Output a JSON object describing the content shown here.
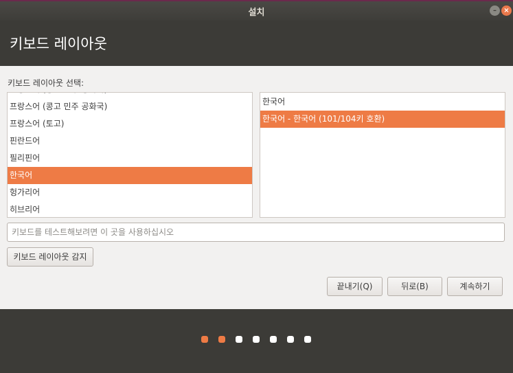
{
  "window": {
    "title": "설치"
  },
  "header": {
    "title": "키보드 레이아웃"
  },
  "layout_list": {
    "label": "키보드 레이아웃 선택:",
    "items": [
      {
        "label": "프랑스어 (콩고 민주 공화국)",
        "selected": false
      },
      {
        "label": "프랑스어 (콩고 민주 공화국)",
        "selected": false
      },
      {
        "label": "프랑스어 (토고)",
        "selected": false
      },
      {
        "label": "핀란드어",
        "selected": false
      },
      {
        "label": "필리핀어",
        "selected": false
      },
      {
        "label": "한국어",
        "selected": true
      },
      {
        "label": "헝가리어",
        "selected": false
      },
      {
        "label": "히브리어",
        "selected": false
      }
    ]
  },
  "variant_list": {
    "items": [
      {
        "label": "한국어",
        "selected": false
      },
      {
        "label": "한국어 - 한국어 (101/104키 호환)",
        "selected": true
      }
    ]
  },
  "test_input": {
    "placeholder": "키보드를 테스트해보려면 이 곳을 사용하십시오",
    "value": ""
  },
  "buttons": {
    "detect": "키보드 레이아웃 감지",
    "quit": "끝내기(Q)",
    "back": "뒤로(B)",
    "continue": "계속하기"
  },
  "progress": {
    "total_steps": 7,
    "completed_steps": 2
  },
  "colors": {
    "accent": "#ee7b45",
    "dark": "#3c3b37",
    "content_bg": "#f2f1f0"
  }
}
